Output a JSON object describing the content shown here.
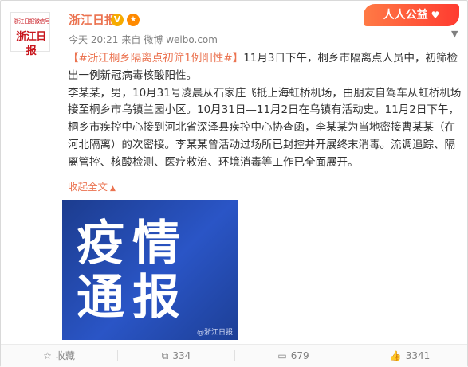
{
  "post": {
    "avatar": {
      "small_text": "浙江日报微信号",
      "big_text": "浙江日报"
    },
    "author": "浙江日报",
    "verified_badge": "V",
    "medal_icon": "medal-icon",
    "meta": {
      "time": "今天 20:21",
      "source_prefix": "来自",
      "source": "微博 weibo.com"
    },
    "campaign_badge": "人人公益",
    "content": {
      "topic": "【#浙江桐乡隔离点初筛1例阳性#】",
      "paragraph1_rest": "11月3日下午，桐乡市隔离点人员中，初筛检出一例新冠病毒核酸阳性。",
      "paragraph2": "李某某，男，10月31号凌晨从石家庄飞抵上海虹桥机场，由朋友自驾车从虹桥机场接至桐乡市乌镇兰园小区。10月31日—11月2日在乌镇有活动史。11月2日下午，桐乡市疾控中心接到河北省深泽县疾控中心协查函，李某某为当地密接曹某某（在河北隔离）的次密接。李某某曾活动过场所已封控并开展终末消毒。流调追踪、隔离管控、核酸检测、医疗救治、环境消毒等工作已全面展开。"
    },
    "collapse_label": "收起全文",
    "image": {
      "line1": "疫情",
      "line2": "通报",
      "watermark": "@浙江日报"
    }
  },
  "footer": {
    "collect": "收藏",
    "repost": "334",
    "comment": "679",
    "like": "3341"
  },
  "colors": {
    "accent": "#eb7350",
    "link": "#eb7350",
    "image_bg": "#1c3c8e",
    "brand_red": "#c8161d"
  }
}
